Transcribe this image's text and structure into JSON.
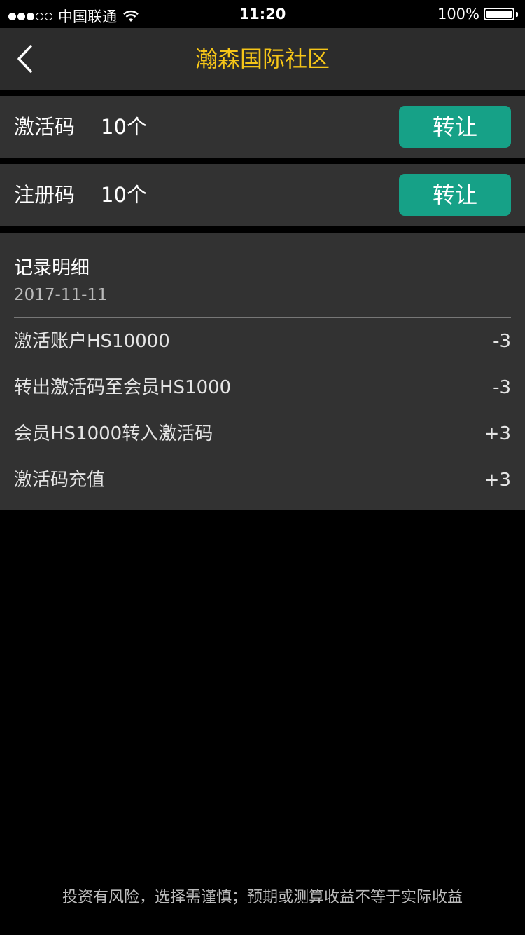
{
  "status_bar": {
    "carrier": "中国联通",
    "time": "11:20",
    "battery": "100%"
  },
  "nav": {
    "title": "瀚森国际社区",
    "back_icon": "chevron-left-icon"
  },
  "codes": [
    {
      "label": "激活码",
      "count": "10个",
      "button": "转让"
    },
    {
      "label": "注册码",
      "count": "10个",
      "button": "转让"
    }
  ],
  "records": {
    "title": "记录明细",
    "date": "2017-11-11",
    "items": [
      {
        "desc": "激活账户HS10000",
        "amount": "-3"
      },
      {
        "desc": "转出激活码至会员HS1000",
        "amount": "-3"
      },
      {
        "desc": "会员HS1000转入激活码",
        "amount": "+3"
      },
      {
        "desc": "激活码充值",
        "amount": "+3"
      }
    ]
  },
  "footer": {
    "disclaimer": "投资有风险，选择需谨慎；预期或测算收益不等于实际收益"
  },
  "colors": {
    "accent_title": "#f5c518",
    "button": "#16a187",
    "panel": "#323232",
    "nav": "#2c2c2c"
  }
}
